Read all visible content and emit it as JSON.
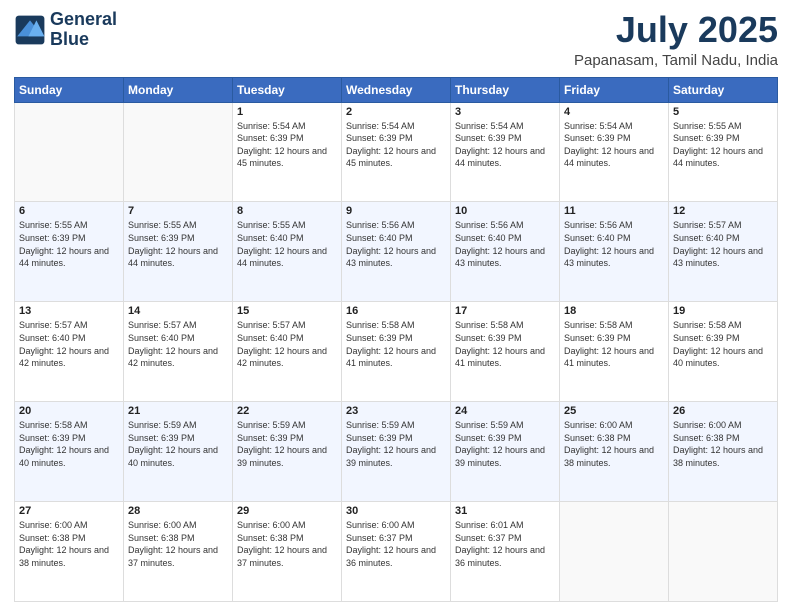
{
  "header": {
    "logo_line1": "General",
    "logo_line2": "Blue",
    "title": "July 2025",
    "subtitle": "Papanasam, Tamil Nadu, India"
  },
  "days_of_week": [
    "Sunday",
    "Monday",
    "Tuesday",
    "Wednesday",
    "Thursday",
    "Friday",
    "Saturday"
  ],
  "weeks": [
    [
      {
        "day": "",
        "empty": true
      },
      {
        "day": "",
        "empty": true
      },
      {
        "day": "1",
        "sunrise": "5:54 AM",
        "sunset": "6:39 PM",
        "daylight": "12 hours and 45 minutes."
      },
      {
        "day": "2",
        "sunrise": "5:54 AM",
        "sunset": "6:39 PM",
        "daylight": "12 hours and 45 minutes."
      },
      {
        "day": "3",
        "sunrise": "5:54 AM",
        "sunset": "6:39 PM",
        "daylight": "12 hours and 44 minutes."
      },
      {
        "day": "4",
        "sunrise": "5:54 AM",
        "sunset": "6:39 PM",
        "daylight": "12 hours and 44 minutes."
      },
      {
        "day": "5",
        "sunrise": "5:55 AM",
        "sunset": "6:39 PM",
        "daylight": "12 hours and 44 minutes."
      }
    ],
    [
      {
        "day": "6",
        "sunrise": "5:55 AM",
        "sunset": "6:39 PM",
        "daylight": "12 hours and 44 minutes."
      },
      {
        "day": "7",
        "sunrise": "5:55 AM",
        "sunset": "6:39 PM",
        "daylight": "12 hours and 44 minutes."
      },
      {
        "day": "8",
        "sunrise": "5:55 AM",
        "sunset": "6:40 PM",
        "daylight": "12 hours and 44 minutes."
      },
      {
        "day": "9",
        "sunrise": "5:56 AM",
        "sunset": "6:40 PM",
        "daylight": "12 hours and 43 minutes."
      },
      {
        "day": "10",
        "sunrise": "5:56 AM",
        "sunset": "6:40 PM",
        "daylight": "12 hours and 43 minutes."
      },
      {
        "day": "11",
        "sunrise": "5:56 AM",
        "sunset": "6:40 PM",
        "daylight": "12 hours and 43 minutes."
      },
      {
        "day": "12",
        "sunrise": "5:57 AM",
        "sunset": "6:40 PM",
        "daylight": "12 hours and 43 minutes."
      }
    ],
    [
      {
        "day": "13",
        "sunrise": "5:57 AM",
        "sunset": "6:40 PM",
        "daylight": "12 hours and 42 minutes."
      },
      {
        "day": "14",
        "sunrise": "5:57 AM",
        "sunset": "6:40 PM",
        "daylight": "12 hours and 42 minutes."
      },
      {
        "day": "15",
        "sunrise": "5:57 AM",
        "sunset": "6:40 PM",
        "daylight": "12 hours and 42 minutes."
      },
      {
        "day": "16",
        "sunrise": "5:58 AM",
        "sunset": "6:39 PM",
        "daylight": "12 hours and 41 minutes."
      },
      {
        "day": "17",
        "sunrise": "5:58 AM",
        "sunset": "6:39 PM",
        "daylight": "12 hours and 41 minutes."
      },
      {
        "day": "18",
        "sunrise": "5:58 AM",
        "sunset": "6:39 PM",
        "daylight": "12 hours and 41 minutes."
      },
      {
        "day": "19",
        "sunrise": "5:58 AM",
        "sunset": "6:39 PM",
        "daylight": "12 hours and 40 minutes."
      }
    ],
    [
      {
        "day": "20",
        "sunrise": "5:58 AM",
        "sunset": "6:39 PM",
        "daylight": "12 hours and 40 minutes."
      },
      {
        "day": "21",
        "sunrise": "5:59 AM",
        "sunset": "6:39 PM",
        "daylight": "12 hours and 40 minutes."
      },
      {
        "day": "22",
        "sunrise": "5:59 AM",
        "sunset": "6:39 PM",
        "daylight": "12 hours and 39 minutes."
      },
      {
        "day": "23",
        "sunrise": "5:59 AM",
        "sunset": "6:39 PM",
        "daylight": "12 hours and 39 minutes."
      },
      {
        "day": "24",
        "sunrise": "5:59 AM",
        "sunset": "6:39 PM",
        "daylight": "12 hours and 39 minutes."
      },
      {
        "day": "25",
        "sunrise": "6:00 AM",
        "sunset": "6:38 PM",
        "daylight": "12 hours and 38 minutes."
      },
      {
        "day": "26",
        "sunrise": "6:00 AM",
        "sunset": "6:38 PM",
        "daylight": "12 hours and 38 minutes."
      }
    ],
    [
      {
        "day": "27",
        "sunrise": "6:00 AM",
        "sunset": "6:38 PM",
        "daylight": "12 hours and 38 minutes."
      },
      {
        "day": "28",
        "sunrise": "6:00 AM",
        "sunset": "6:38 PM",
        "daylight": "12 hours and 37 minutes."
      },
      {
        "day": "29",
        "sunrise": "6:00 AM",
        "sunset": "6:38 PM",
        "daylight": "12 hours and 37 minutes."
      },
      {
        "day": "30",
        "sunrise": "6:00 AM",
        "sunset": "6:37 PM",
        "daylight": "12 hours and 36 minutes."
      },
      {
        "day": "31",
        "sunrise": "6:01 AM",
        "sunset": "6:37 PM",
        "daylight": "12 hours and 36 minutes."
      },
      {
        "day": "",
        "empty": true
      },
      {
        "day": "",
        "empty": true
      }
    ]
  ],
  "labels": {
    "sunrise": "Sunrise:",
    "sunset": "Sunset:",
    "daylight": "Daylight:"
  }
}
